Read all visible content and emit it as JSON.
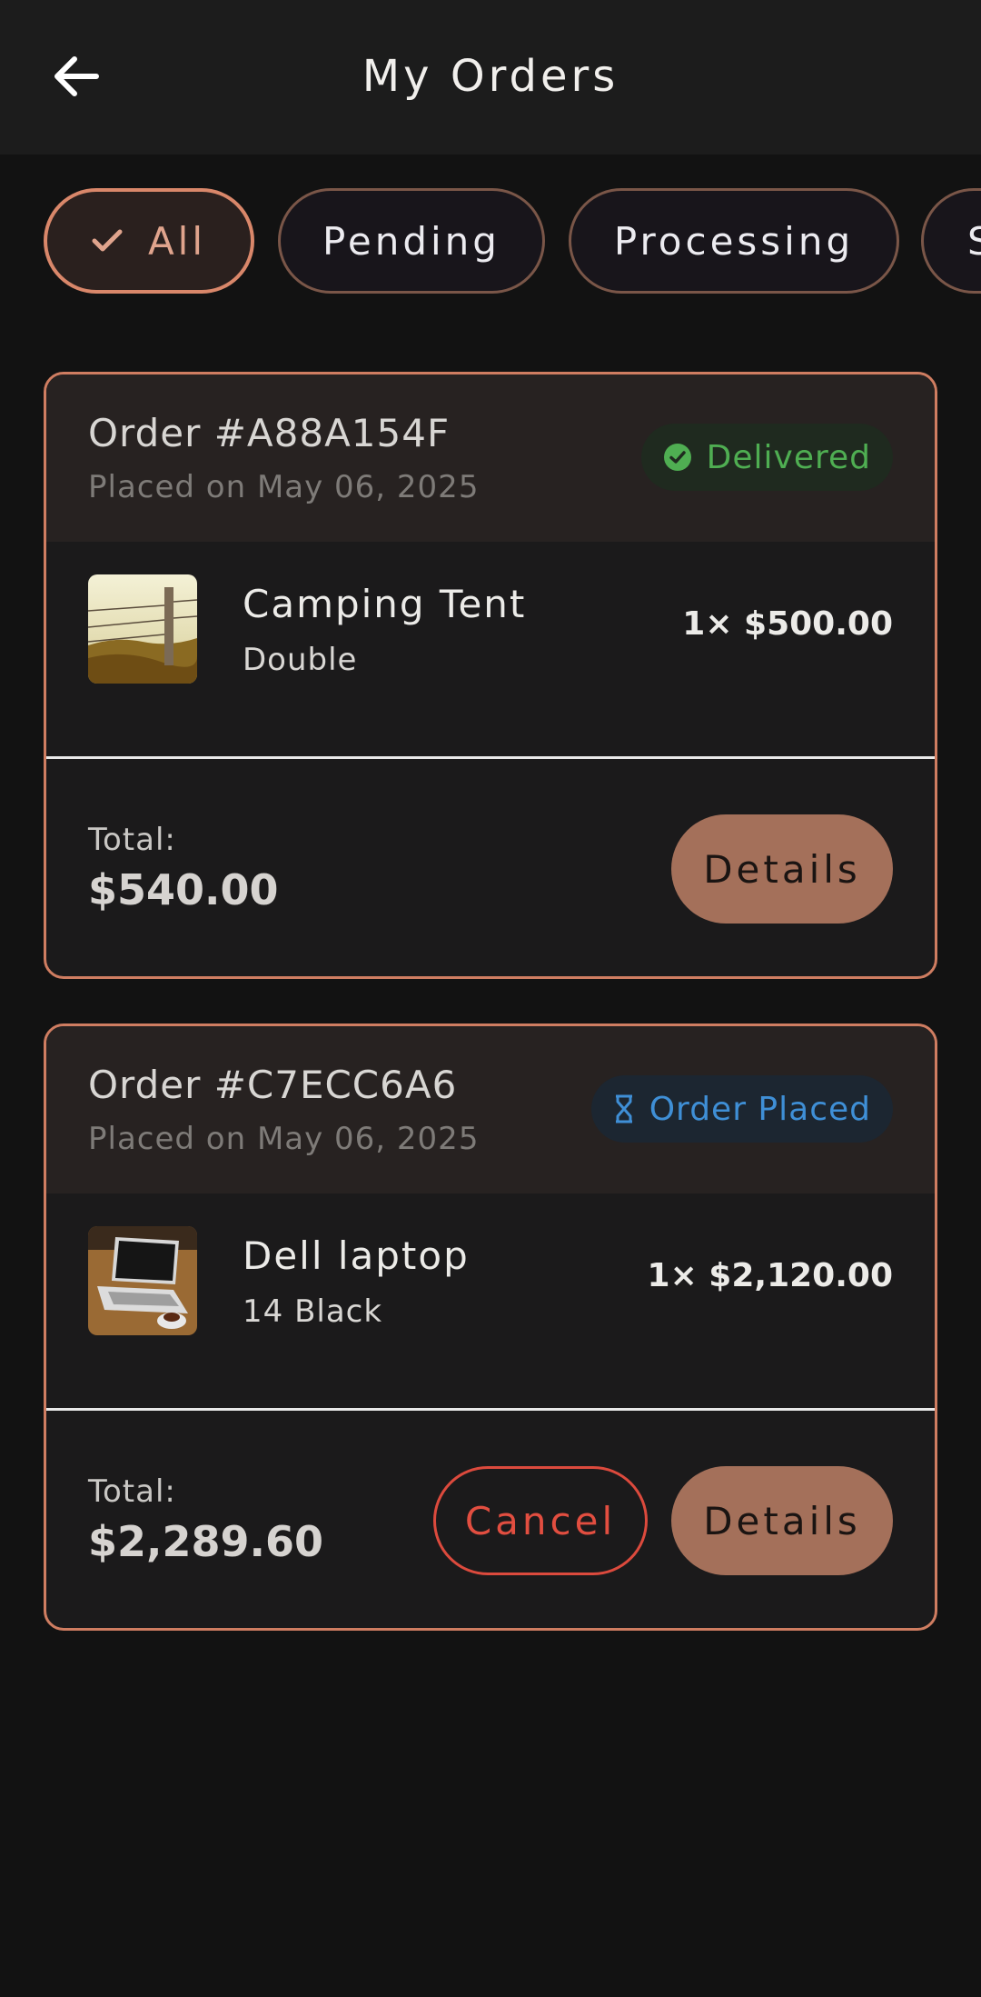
{
  "header": {
    "title": "My Orders",
    "back_icon": "arrow-left-icon"
  },
  "filters": [
    {
      "label": "All",
      "selected": true,
      "icon": "check-icon"
    },
    {
      "label": "Pending",
      "selected": false
    },
    {
      "label": "Processing",
      "selected": false
    },
    {
      "label": "S",
      "selected": false
    }
  ],
  "orders": [
    {
      "id": "Order #A88A154F",
      "date": "Placed on May 06, 2025",
      "status": {
        "label": "Delivered",
        "icon": "check-circle-icon",
        "color": "#4fae52"
      },
      "item": {
        "name": "Camping Tent",
        "variant": "Double",
        "qty_price": "1× $500.00"
      },
      "total_label": "Total:",
      "total": "$540.00",
      "details_label": "Details"
    },
    {
      "id": "Order #C7ECC6A6",
      "date": "Placed on May 06, 2025",
      "status": {
        "label": "Order Placed",
        "icon": "hourglass-icon",
        "color": "#3f8fd6"
      },
      "item": {
        "name": "Dell laptop",
        "variant": "14 Black",
        "qty_price": "1× $2,120.00"
      },
      "total_label": "Total:",
      "total": "$2,289.60",
      "cancel_label": "Cancel",
      "details_label": "Details"
    }
  ],
  "colors": {
    "accent": "#cf7d61",
    "button": "#a4705a",
    "cancel": "#dc4a3d",
    "background": "#121212"
  }
}
